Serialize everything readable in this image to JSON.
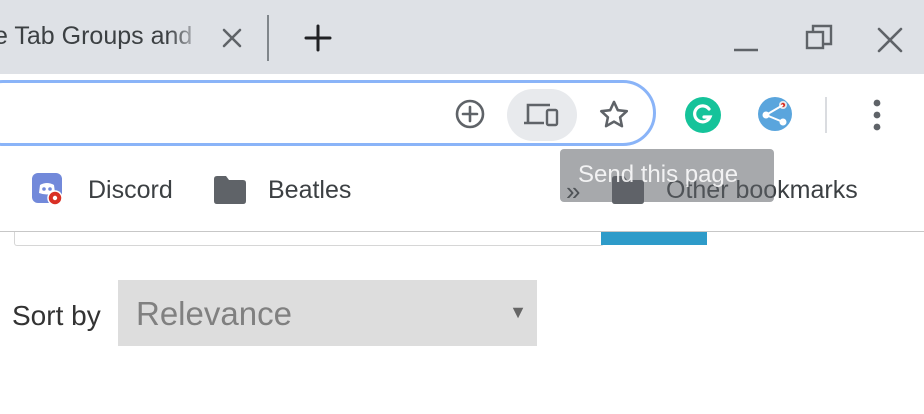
{
  "tab": {
    "title": "e Tab Groups and"
  },
  "bookmarks": {
    "items": [
      {
        "label": "Discord"
      },
      {
        "label": "Beatles"
      }
    ],
    "overflow": "»",
    "other": "Other bookmarks"
  },
  "tooltip": {
    "text": "Send this page"
  },
  "page": {
    "sort_label": "Sort by",
    "sort_value": "Relevance"
  },
  "colors": {
    "omnibox_focus": "#8ab4f8",
    "grammarly": "#15c39a",
    "discord": "#7289da",
    "search_button": "#2e9bc9"
  }
}
